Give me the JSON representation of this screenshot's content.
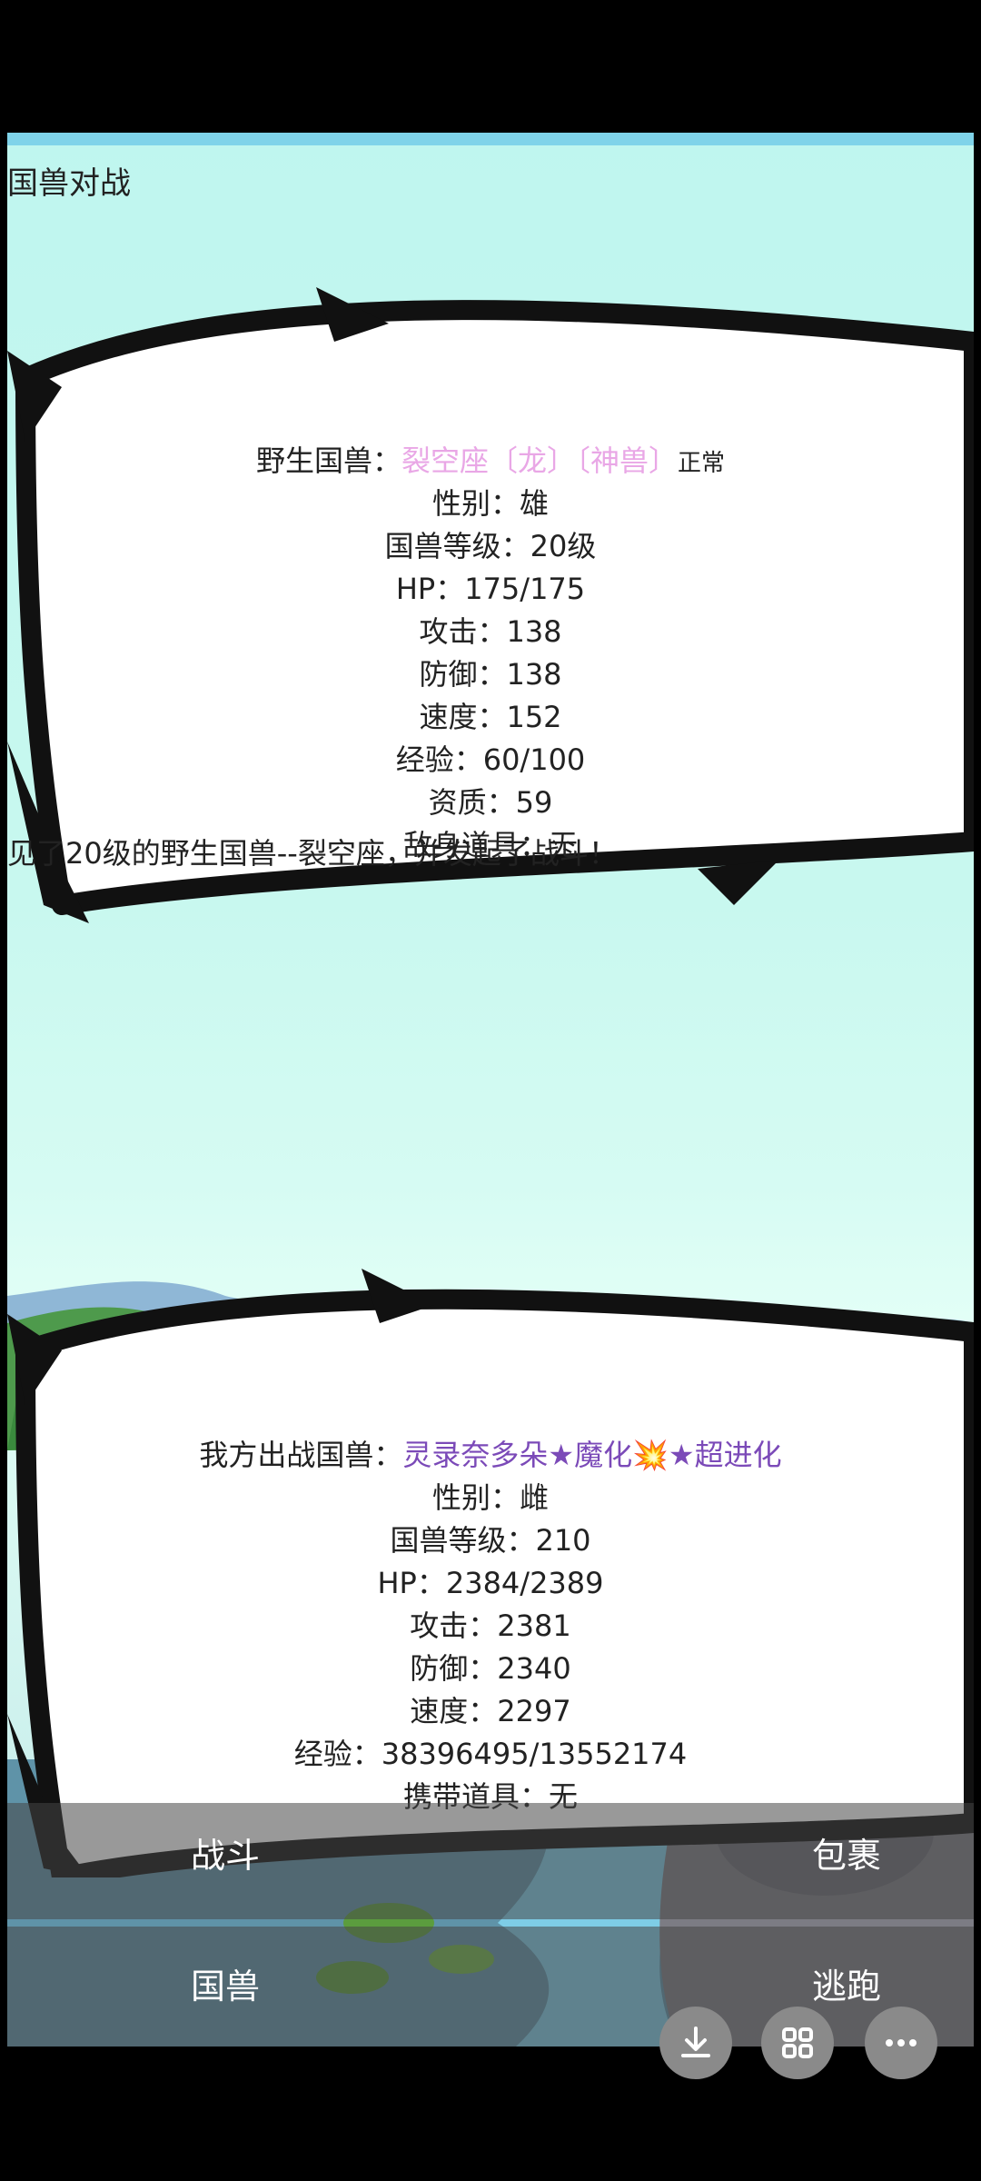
{
  "app": {
    "title": "国兽对战"
  },
  "enemy": {
    "name_prefix": "野生国兽：",
    "name": "裂空座〔龙〕〔神兽〕",
    "status": "正常",
    "gender": "性别：雄",
    "level": "国兽等级：20级",
    "hp": "HP：175/175",
    "attack": "攻击：138",
    "defense": "防御：138",
    "speed": "速度：152",
    "exp": "经验：60/100",
    "aptitude": "资质：59",
    "item": "敌身道具：无"
  },
  "battle_message": "见了20级的野生国兽--裂空座，并发起了战斗！",
  "player": {
    "name_prefix": "我方出战国兽：",
    "name": "灵录奈多朵★魔化💥★超进化",
    "gender": "性别：雌",
    "level": "国兽等级：210",
    "hp": "HP：2384/2389",
    "attack": "攻击：2381",
    "defense": "防御：2340",
    "speed": "速度：2297",
    "exp": "经验：38396495/13552174",
    "item": "携带道具：无"
  },
  "menu": {
    "fight": "战斗",
    "bag": "包裹",
    "beasts": "国兽",
    "flee": "逃跑"
  },
  "fab_icons": [
    "download-icon",
    "grid-icon",
    "more-icon"
  ],
  "colors": {
    "enemy_name": "#e9a7e6",
    "player_name": "#7b4ab8",
    "menu_bg": "#464646"
  }
}
